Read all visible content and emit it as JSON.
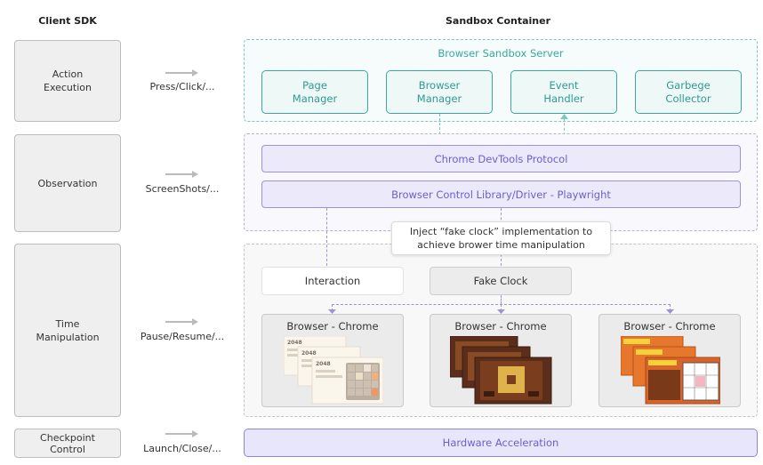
{
  "headers": {
    "client_sdk": "Client SDK",
    "sandbox_container": "Sandbox Container"
  },
  "sdk": {
    "action_execution": "Action\nExecution",
    "observation": "Observation",
    "time_manipulation": "Time\nManipulation",
    "checkpoint_control": "Checkpoint\nControl"
  },
  "actions": {
    "press_click": "Press/Click/...",
    "screenshots": "ScreenShots/...",
    "pause_resume": "Pause/Resume/...",
    "launch_close": "Launch/Close/..."
  },
  "server": {
    "title": "Browser Sandbox Server",
    "components": [
      "Page\nManager",
      "Browser\nManager",
      "Event\nHandler",
      "Garbege\nCollector"
    ]
  },
  "protocol": {
    "cdp": "Chrome DevTools Protocol",
    "playwright": "Browser Control Library/Driver - Playwright"
  },
  "note": "Inject “fake clock” implementation to\nachieve brower time manipulation",
  "time": {
    "interaction": "Interaction",
    "fake_clock": "Fake Clock",
    "browsers": [
      "Browser - Chrome",
      "Browser - Chrome",
      "Browser - Chrome"
    ],
    "game_2048_label": "2048"
  },
  "hardware": "Hardware Acceleration",
  "colors": {
    "teal": "#3aa89c",
    "purple": "#6b5fd0",
    "grey_box": "#efefef"
  }
}
